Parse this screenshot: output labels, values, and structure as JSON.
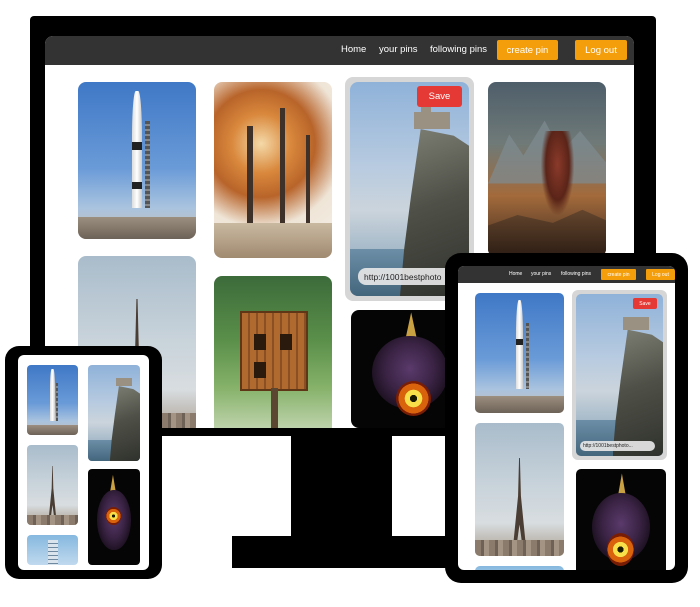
{
  "desktop": {
    "nav": {
      "home": "Home",
      "your_pins": "your pins",
      "following_pins": "following pins",
      "create_pin": "create pin",
      "log_out": "Log out"
    },
    "selected_pin": {
      "save_label": "Save",
      "url_text": "http://1001bestphoto"
    },
    "pins": [
      {
        "subject": "rocket-launch"
      },
      {
        "subject": "autumn-trees"
      },
      {
        "subject": "cliff-castle"
      },
      {
        "subject": "armored-warrior"
      },
      {
        "subject": "eiffel-tower"
      },
      {
        "subject": "treehouse"
      },
      {
        "subject": "majoras-mask"
      }
    ]
  },
  "tablet": {
    "nav": {
      "home": "Home",
      "your_pins": "your pins",
      "following_pins": "following pins",
      "create_pin": "create pin",
      "log_out": "Log out"
    },
    "selected_pin": {
      "save_label": "Save",
      "url_text": "http://1001bestphoto..."
    }
  },
  "colors": {
    "navbar": "#333333",
    "accent_button": "#f59e0b",
    "save_button": "#e53935",
    "device_frame": "#000000",
    "background": "#ffffff"
  }
}
